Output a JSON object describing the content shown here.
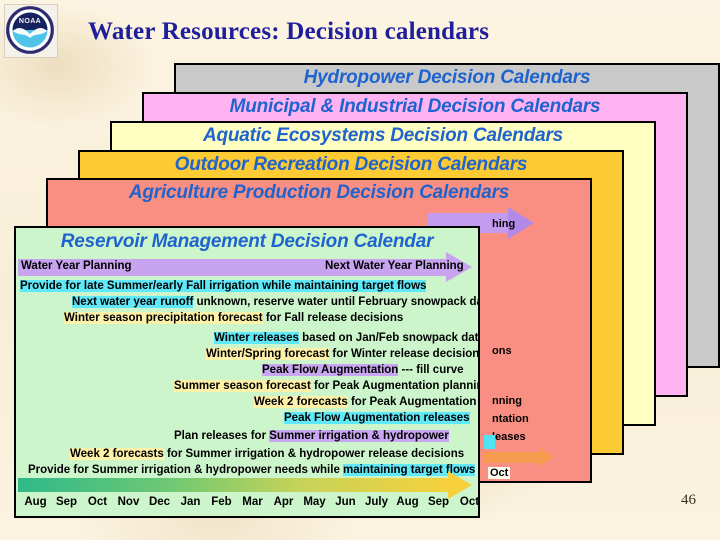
{
  "slide": {
    "title": "Water Resources: Decision calendars",
    "number": "46",
    "logo_name": "NOAA",
    "title_color": "#1f1f9c",
    "background_color": "#fbf2de"
  },
  "stack": {
    "panels": [
      {
        "title": "Hydropower Decision Calendars",
        "color": "#c9c9c9",
        "fragments": [
          "hing",
          "ons",
          "nning",
          "ntation",
          "leases"
        ],
        "oct_label": "Oct"
      },
      {
        "title": "Municipal & Industrial Decision Calendars",
        "color": "#ffb3f0",
        "fragments": [
          "hing",
          "ons",
          "nning",
          "ntation",
          "leases"
        ],
        "oct_label": "Oct"
      },
      {
        "title": "Aquatic Ecosystems Decision Calendars",
        "color": "#ffffc2",
        "fragments": [
          "hing",
          "ons",
          "nning",
          "ntation",
          "leases"
        ],
        "oct_label": "Oct"
      },
      {
        "title": "Outdoor Recreation Decision Calendars",
        "color": "#fcca33",
        "fragments": [
          "hing",
          "ons",
          "nning",
          "ntation",
          "leases"
        ],
        "oct_label": "Oct"
      },
      {
        "title": "Agriculture Production Decision Calendars",
        "color": "#f98e82",
        "fragments": [
          "hing",
          "ons",
          "nning",
          "ntation",
          "leases"
        ],
        "oct_label": "Oct"
      }
    ]
  },
  "reservoir": {
    "title": "Reservoir Management Decision Calendar",
    "background_color": "#ccf5cc",
    "water_year_left": "Water Year Planning",
    "water_year_right": "Next Water Year Planning",
    "lines": [
      {
        "text": "Provide for late Summer/early Fall irrigation while maintaining target flows",
        "highlight": "cyan",
        "highlight_part": "all"
      },
      {
        "text": "Next water year runoff unknown, reserve water until February snowpack data",
        "highlight": "cyan",
        "highlight_part": "Next water year runoff"
      },
      {
        "text": "Winter season precipitation forecast for Fall release decisions",
        "highlight": "yellow",
        "highlight_part": "Winter season precipitation forecast"
      },
      {
        "text": "Winter releases based on Jan/Feb snowpack data",
        "highlight": "cyan",
        "highlight_part": "Winter releases"
      },
      {
        "text": "Winter/Spring forecast for Winter release decisions",
        "highlight": "yellow",
        "highlight_part": "Winter/Spring forecast"
      },
      {
        "text": "Peak Flow Augmentation --- fill curve",
        "highlight": "purple",
        "highlight_part": "Peak Flow Augmentation"
      },
      {
        "text": "Summer season forecast for Peak Augmentation planning",
        "highlight": "yellow",
        "highlight_part": "Summer season forecast"
      },
      {
        "text": "Week 2 forecasts for Peak Augmentation",
        "highlight": "yellow",
        "highlight_part": "Week 2 forecasts"
      },
      {
        "text": "Peak Flow Augmentation releases",
        "highlight": "cyan",
        "highlight_part": "all"
      },
      {
        "text": "Plan releases for Summer irrigation & hydropower",
        "highlight": "purple",
        "highlight_part": "Summer irrigation & hydropower"
      },
      {
        "text": "Week 2 forecasts for Summer irrigation & hydropower release decisions",
        "highlight": "yellow",
        "highlight_part": "Week 2 forecasts"
      },
      {
        "text": "Provide for Summer irrigation & hydropower needs while maintaining target flows",
        "highlight": "cyan",
        "highlight_part": "maintaining target flows"
      }
    ],
    "line_segments": [
      [
        {
          "t": "Provide for late Summer/early Fall irrigation while maintaining target flows",
          "h": "cyan"
        }
      ],
      [
        {
          "t": "Next water year runoff",
          "h": "cyan"
        },
        {
          "t": " unknown, reserve water until February snowpack data",
          "h": "none"
        }
      ],
      [
        {
          "t": "Winter season precipitation forecast",
          "h": "yellow"
        },
        {
          "t": " for Fall release decisions",
          "h": "none"
        }
      ],
      [
        {
          "t": "Winter releases",
          "h": "cyan"
        },
        {
          "t": " based on Jan/Feb snowpack data",
          "h": "none"
        }
      ],
      [
        {
          "t": "Winter/Spring forecast",
          "h": "yellow"
        },
        {
          "t": " for Winter release decisions",
          "h": "none"
        }
      ],
      [
        {
          "t": "Peak Flow Augmentation",
          "h": "purple"
        },
        {
          "t": " --- fill curve",
          "h": "none"
        }
      ],
      [
        {
          "t": "Summer season forecast",
          "h": "yellow"
        },
        {
          "t": " for Peak Augmentation planning",
          "h": "none"
        }
      ],
      [
        {
          "t": "Week 2 forecasts",
          "h": "yellow"
        },
        {
          "t": " for Peak Augmentation",
          "h": "none"
        }
      ],
      [
        {
          "t": "Peak Flow Augmentation releases",
          "h": "cyan"
        }
      ],
      [
        {
          "t": "Plan releases for ",
          "h": "none"
        },
        {
          "t": "Summer irrigation & hydropower",
          "h": "purple"
        }
      ],
      [
        {
          "t": "Week 2 forecasts",
          "h": "yellow"
        },
        {
          "t": " for Summer irrigation & hydropower release decisions",
          "h": "none"
        }
      ],
      [
        {
          "t": "Provide for Summer irrigation & hydropower needs while ",
          "h": "none"
        },
        {
          "t": "maintaining target flows",
          "h": "cyan"
        }
      ]
    ],
    "months": [
      "Aug",
      "Sep",
      "Oct",
      "Nov",
      "Dec",
      "Jan",
      "Feb",
      "Mar",
      "Apr",
      "May",
      "Jun",
      "July",
      "Aug",
      "Sep",
      "Oct"
    ]
  }
}
